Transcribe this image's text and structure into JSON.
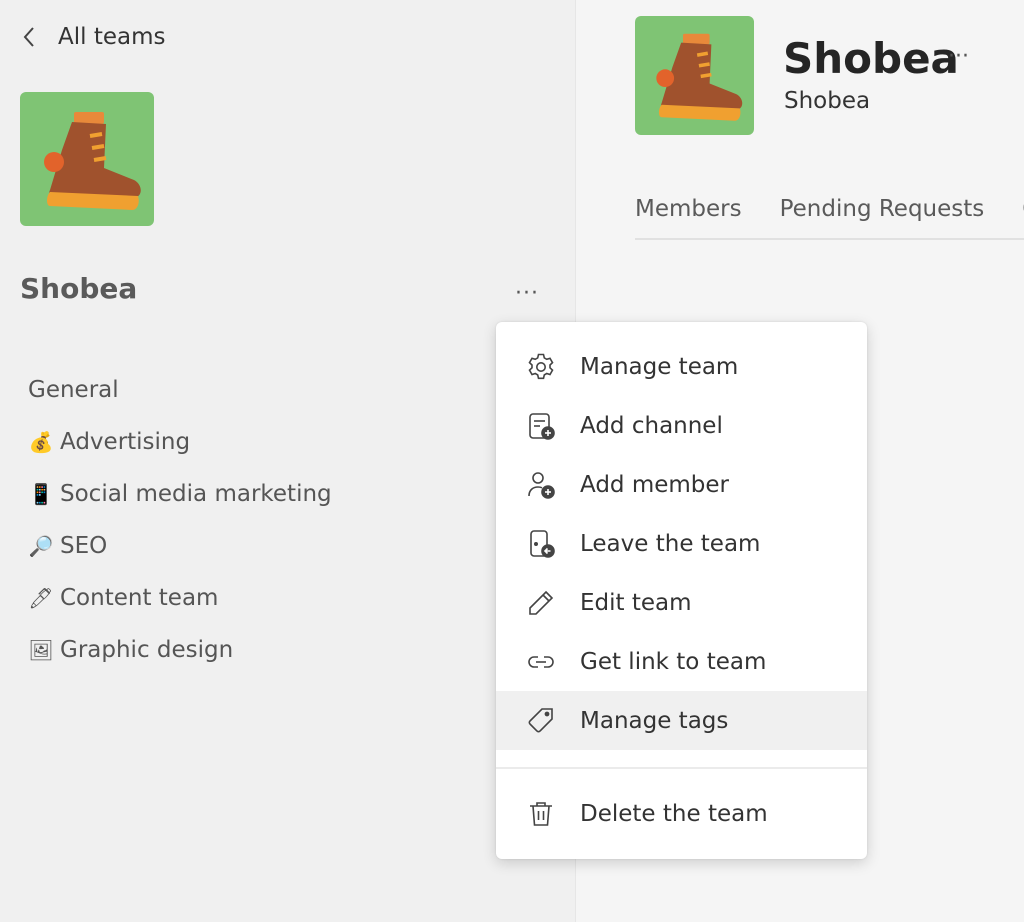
{
  "sidebar": {
    "back_label": "All teams",
    "team_name": "Shobea",
    "more_label": "···",
    "channels": [
      {
        "emoji": "",
        "label": "General"
      },
      {
        "emoji": "💰",
        "label": "Advertising"
      },
      {
        "emoji": "📱",
        "label": "Social media marketing"
      },
      {
        "emoji": "🔎",
        "label": "SEO"
      },
      {
        "emoji": "🖊",
        "label": "Content team"
      },
      {
        "emoji": "🖼",
        "label": "Graphic design"
      }
    ]
  },
  "main": {
    "title": "Shobea",
    "subtitle": "Shobea",
    "more_label": "···",
    "tabs": [
      "Members",
      "Pending Requests",
      "C"
    ]
  },
  "menu": {
    "items": [
      {
        "label": "Manage team",
        "icon": "gear-icon"
      },
      {
        "label": "Add channel",
        "icon": "add-channel-icon"
      },
      {
        "label": "Add member",
        "icon": "add-member-icon"
      },
      {
        "label": "Leave the team",
        "icon": "leave-icon"
      },
      {
        "label": "Edit team",
        "icon": "pencil-icon"
      },
      {
        "label": "Get link to team",
        "icon": "link-icon"
      },
      {
        "label": "Manage tags",
        "icon": "tag-icon"
      }
    ],
    "delete_label": "Delete the team",
    "hovered_item": "Manage tags"
  },
  "colors": {
    "avatar_bg": "#7fc474",
    "boot_brown": "#a0522d",
    "boot_orange": "#f0a030",
    "hover_bg": "#f0f0f0"
  }
}
